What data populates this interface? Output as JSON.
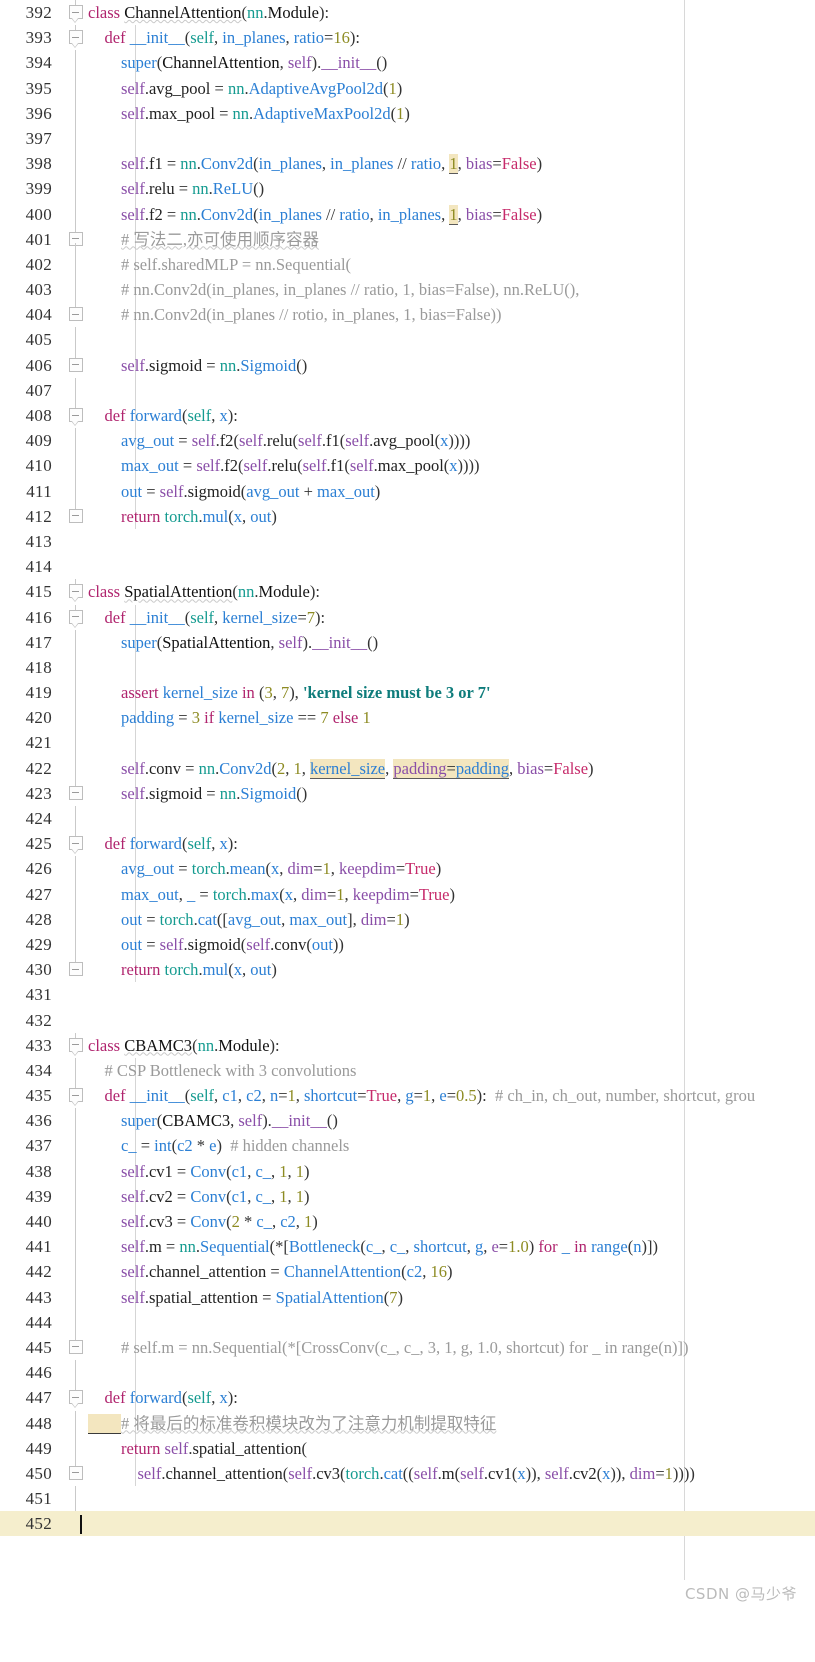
{
  "editor": {
    "first_line": 392,
    "last_line": 452,
    "current_line": 452,
    "margin_guide_column_x": 684,
    "colors": {
      "background": "#ffffff",
      "current_line_highlight": "#f5eecd",
      "occurrence_highlight": "#f3e6bf",
      "keyword": "#b0246e",
      "self": "#8a4fa8",
      "module": "#159b90",
      "function": "#2b7fd4",
      "number": "#8d8b22",
      "string": "#0e7c7b",
      "comment": "#9a9a9a",
      "line_number": "#333333",
      "margin_guide": "#d8d8d8"
    }
  },
  "watermark": {
    "text": "CSDN @马少爷"
  },
  "lines": [
    {
      "n": 392,
      "text": "class ChannelAttention(nn.Module):"
    },
    {
      "n": 393,
      "text": "    def __init__(self, in_planes, ratio=16):"
    },
    {
      "n": 394,
      "text": "        super(ChannelAttention, self).__init__()"
    },
    {
      "n": 395,
      "text": "        self.avg_pool = nn.AdaptiveAvgPool2d(1)"
    },
    {
      "n": 396,
      "text": "        self.max_pool = nn.AdaptiveMaxPool2d(1)"
    },
    {
      "n": 397,
      "text": ""
    },
    {
      "n": 398,
      "text": "        self.f1 = nn.Conv2d(in_planes, in_planes // ratio, 1, bias=False)"
    },
    {
      "n": 399,
      "text": "        self.relu = nn.ReLU()"
    },
    {
      "n": 400,
      "text": "        self.f2 = nn.Conv2d(in_planes // ratio, in_planes, 1, bias=False)"
    },
    {
      "n": 401,
      "text": "        # 写法二,亦可使用顺序容器"
    },
    {
      "n": 402,
      "text": "        # self.sharedMLP = nn.Sequential("
    },
    {
      "n": 403,
      "text": "        # nn.Conv2d(in_planes, in_planes // ratio, 1, bias=False), nn.ReLU(),"
    },
    {
      "n": 404,
      "text": "        # nn.Conv2d(in_planes // rotio, in_planes, 1, bias=False))"
    },
    {
      "n": 405,
      "text": ""
    },
    {
      "n": 406,
      "text": "        self.sigmoid = nn.Sigmoid()"
    },
    {
      "n": 407,
      "text": ""
    },
    {
      "n": 408,
      "text": "    def forward(self, x):"
    },
    {
      "n": 409,
      "text": "        avg_out = self.f2(self.relu(self.f1(self.avg_pool(x))))"
    },
    {
      "n": 410,
      "text": "        max_out = self.f2(self.relu(self.f1(self.max_pool(x))))"
    },
    {
      "n": 411,
      "text": "        out = self.sigmoid(avg_out + max_out)"
    },
    {
      "n": 412,
      "text": "        return torch.mul(x, out)"
    },
    {
      "n": 413,
      "text": ""
    },
    {
      "n": 414,
      "text": ""
    },
    {
      "n": 415,
      "text": "class SpatialAttention(nn.Module):"
    },
    {
      "n": 416,
      "text": "    def __init__(self, kernel_size=7):"
    },
    {
      "n": 417,
      "text": "        super(SpatialAttention, self).__init__()"
    },
    {
      "n": 418,
      "text": ""
    },
    {
      "n": 419,
      "text": "        assert kernel_size in (3, 7), 'kernel size must be 3 or 7'"
    },
    {
      "n": 420,
      "text": "        padding = 3 if kernel_size == 7 else 1"
    },
    {
      "n": 421,
      "text": ""
    },
    {
      "n": 422,
      "text": "        self.conv = nn.Conv2d(2, 1, kernel_size, padding=padding, bias=False)"
    },
    {
      "n": 423,
      "text": "        self.sigmoid = nn.Sigmoid()"
    },
    {
      "n": 424,
      "text": ""
    },
    {
      "n": 425,
      "text": "    def forward(self, x):"
    },
    {
      "n": 426,
      "text": "        avg_out = torch.mean(x, dim=1, keepdim=True)"
    },
    {
      "n": 427,
      "text": "        max_out, _ = torch.max(x, dim=1, keepdim=True)"
    },
    {
      "n": 428,
      "text": "        out = torch.cat([avg_out, max_out], dim=1)"
    },
    {
      "n": 429,
      "text": "        out = self.sigmoid(self.conv(out))"
    },
    {
      "n": 430,
      "text": "        return torch.mul(x, out)"
    },
    {
      "n": 431,
      "text": ""
    },
    {
      "n": 432,
      "text": ""
    },
    {
      "n": 433,
      "text": "class CBAMC3(nn.Module):"
    },
    {
      "n": 434,
      "text": "    # CSP Bottleneck with 3 convolutions"
    },
    {
      "n": 435,
      "text": "    def __init__(self, c1, c2, n=1, shortcut=True, g=1, e=0.5):  # ch_in, ch_out, number, shortcut, grou"
    },
    {
      "n": 436,
      "text": "        super(CBAMC3, self).__init__()"
    },
    {
      "n": 437,
      "text": "        c_ = int(c2 * e)  # hidden channels"
    },
    {
      "n": 438,
      "text": "        self.cv1 = Conv(c1, c_, 1, 1)"
    },
    {
      "n": 439,
      "text": "        self.cv2 = Conv(c1, c_, 1, 1)"
    },
    {
      "n": 440,
      "text": "        self.cv3 = Conv(2 * c_, c2, 1)"
    },
    {
      "n": 441,
      "text": "        self.m = nn.Sequential(*[Bottleneck(c_, c_, shortcut, g, e=1.0) for _ in range(n)])"
    },
    {
      "n": 442,
      "text": "        self.channel_attention = ChannelAttention(c2, 16)"
    },
    {
      "n": 443,
      "text": "        self.spatial_attention = SpatialAttention(7)"
    },
    {
      "n": 444,
      "text": ""
    },
    {
      "n": 445,
      "text": "        # self.m = nn.Sequential(*[CrossConv(c_, c_, 3, 1, g, 1.0, shortcut) for _ in range(n)])"
    },
    {
      "n": 446,
      "text": ""
    },
    {
      "n": 447,
      "text": "    def forward(self, x):"
    },
    {
      "n": 448,
      "text": "        # 将最后的标准卷积模块改为了注意力机制提取特征"
    },
    {
      "n": 449,
      "text": "        return self.spatial_attention("
    },
    {
      "n": 450,
      "text": "            self.channel_attention(self.cv3(torch.cat((self.m(self.cv1(x)), self.cv2(x)), dim=1))))"
    },
    {
      "n": 451,
      "text": ""
    },
    {
      "n": 452,
      "text": ""
    }
  ]
}
